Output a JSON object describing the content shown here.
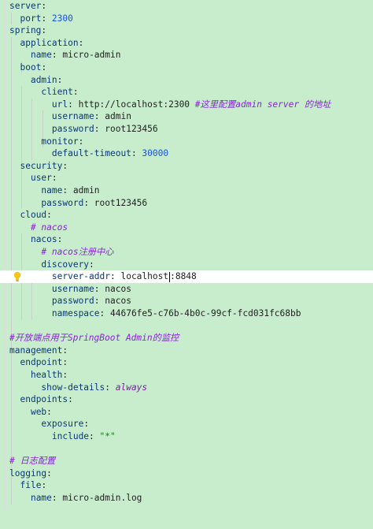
{
  "lines": [
    {
      "key": "server",
      "value": "",
      "comment": ""
    },
    {
      "key": "port",
      "value": "2300",
      "comment": ""
    },
    {
      "key": "spring",
      "value": "",
      "comment": ""
    },
    {
      "key": "application",
      "value": "",
      "comment": ""
    },
    {
      "key": "name",
      "value": "micro-admin",
      "comment": ""
    },
    {
      "key": "boot",
      "value": "",
      "comment": ""
    },
    {
      "key": "admin",
      "value": "",
      "comment": ""
    },
    {
      "key": "client",
      "value": "",
      "comment": ""
    },
    {
      "key": "url",
      "value": "http://localhost:2300",
      "comment": "#这里配置admin server 的地址"
    },
    {
      "key": "username",
      "value": "admin",
      "comment": ""
    },
    {
      "key": "password",
      "value": "root123456",
      "comment": ""
    },
    {
      "key": "monitor",
      "value": "",
      "comment": ""
    },
    {
      "key": "default-timeout",
      "value": "30000",
      "comment": ""
    },
    {
      "key": "security",
      "value": "",
      "comment": ""
    },
    {
      "key": "user",
      "value": "",
      "comment": ""
    },
    {
      "key": "name",
      "value": "admin",
      "comment": ""
    },
    {
      "key": "password",
      "value": "root123456",
      "comment": ""
    },
    {
      "key": "cloud",
      "value": "",
      "comment": ""
    },
    {
      "key": "",
      "value": "",
      "comment": "# nacos"
    },
    {
      "key": "nacos",
      "value": "",
      "comment": ""
    },
    {
      "key": "",
      "value": "",
      "comment": "# nacos注册中心"
    },
    {
      "key": "discovery",
      "value": "",
      "comment": ""
    },
    {
      "key": "server-addr",
      "value_before_caret": "localhost",
      "value_after_caret": ":8848",
      "comment": ""
    },
    {
      "key": "username",
      "value": "nacos",
      "comment": ""
    },
    {
      "key": "password",
      "value": "nacos",
      "comment": ""
    },
    {
      "key": "namespace",
      "value": "44676fe5-c76b-4b0c-99cf-fcd031fc68bb",
      "comment": ""
    },
    {
      "key": "",
      "value": "",
      "comment": ""
    },
    {
      "key": "",
      "value": "",
      "comment": "#开放端点用于SpringBoot Admin的监控"
    },
    {
      "key": "management",
      "value": "",
      "comment": ""
    },
    {
      "key": "endpoint",
      "value": "",
      "comment": ""
    },
    {
      "key": "health",
      "value": "",
      "comment": ""
    },
    {
      "key": "show-details",
      "value": "always",
      "comment": ""
    },
    {
      "key": "endpoints",
      "value": "",
      "comment": ""
    },
    {
      "key": "web",
      "value": "",
      "comment": ""
    },
    {
      "key": "exposure",
      "value": "",
      "comment": ""
    },
    {
      "key": "include",
      "value": "\"*\"",
      "comment": ""
    },
    {
      "key": "",
      "value": "",
      "comment": ""
    },
    {
      "key": "",
      "value": "",
      "comment": "# 日志配置"
    },
    {
      "key": "logging",
      "value": "",
      "comment": ""
    },
    {
      "key": "file",
      "value": "",
      "comment": ""
    },
    {
      "key": "name",
      "value": "micro-admin.log",
      "comment": ""
    }
  ],
  "theme": {
    "background": "#c7edcc",
    "key_color": "#0a3778",
    "comment_color": "#8c1fe0",
    "number_color": "#1750eb",
    "string_color": "#1a7a1a",
    "current_line": "#ffffff"
  },
  "icons": {
    "gutter": "lightbulb-icon"
  }
}
